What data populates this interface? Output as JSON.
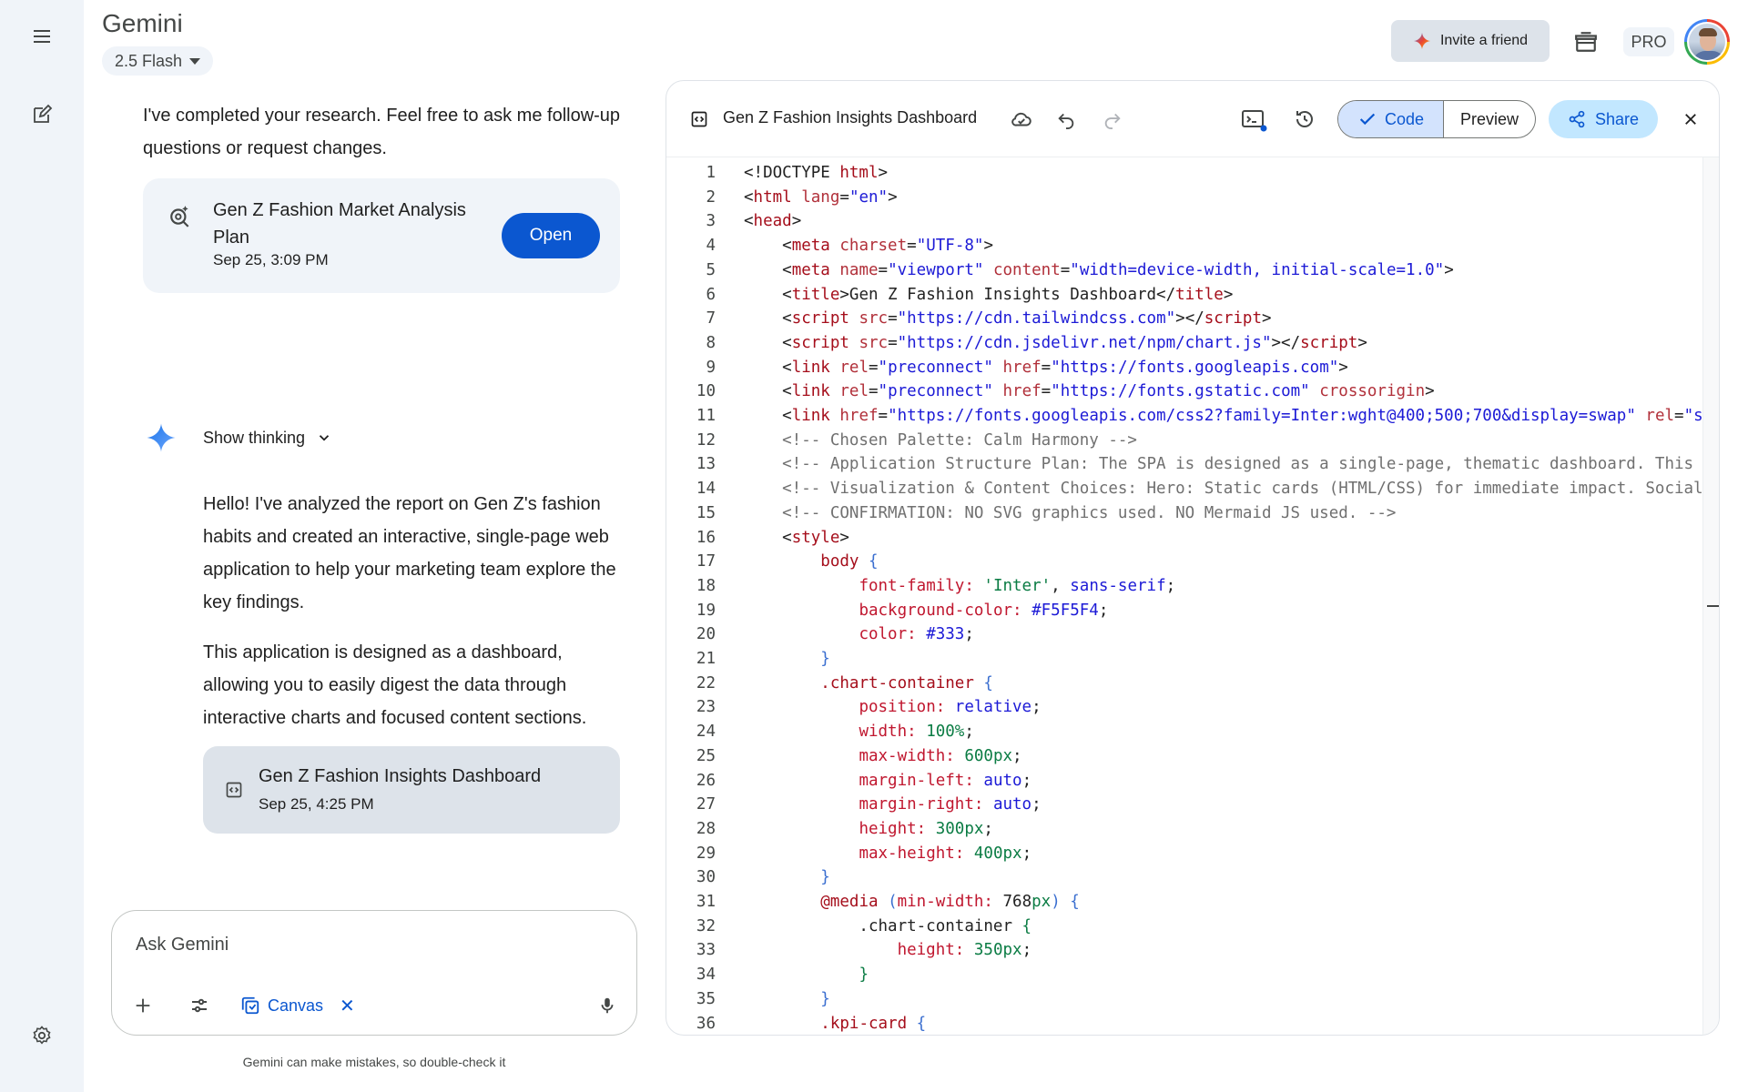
{
  "app": {
    "title": "Gemini",
    "model": "2.5 Flash"
  },
  "header": {
    "invite": "Invite a friend",
    "plan": "PRO"
  },
  "chat": {
    "intro": "I've completed your research. Feel free to ask me follow-up questions or request changes.",
    "research_card": {
      "title": "Gen Z Fashion Market Analysis Plan",
      "date": "Sep 25, 3:09 PM",
      "open": "Open"
    },
    "show_thinking": "Show thinking",
    "para1": "Hello! I've analyzed the report on Gen Z's fashion habits and created an interactive, single-page web application to help your marketing team explore the key findings.",
    "para2": "This application is designed as a dashboard, allowing you to easily digest the data through interactive charts and focused content sections.",
    "doc_card": {
      "title": "Gen Z Fashion Insights Dashboard",
      "date": "Sep 25, 4:25 PM"
    }
  },
  "input": {
    "placeholder": "Ask Gemini",
    "tool_chip": "Canvas"
  },
  "disclaimer": "Gemini can make mistakes, so double-check it",
  "canvas": {
    "title": "Gen Z Fashion Insights Dashboard",
    "tabs": {
      "code": "Code",
      "preview": "Preview"
    },
    "share": "Share",
    "colors": {
      "accent": "#0b57d0",
      "code_tab_bg": "#d3e3fd",
      "share_bg": "#c2e7ff"
    },
    "code_lines": [
      [
        [
          "c-p",
          "<!DOCTYPE "
        ],
        [
          "c-t",
          "html"
        ],
        [
          "c-p",
          ">"
        ]
      ],
      [
        [
          "c-p",
          "<"
        ],
        [
          "c-t",
          "html "
        ],
        [
          "c-a",
          "lang"
        ],
        [
          "c-p",
          "="
        ],
        [
          "c-s",
          "\"en\""
        ],
        [
          "c-p",
          ">"
        ]
      ],
      [
        [
          "c-p",
          "<"
        ],
        [
          "c-t",
          "head"
        ],
        [
          "c-p",
          ">"
        ]
      ],
      [
        [
          "c-p",
          "    <"
        ],
        [
          "c-t",
          "meta "
        ],
        [
          "c-a",
          "charset"
        ],
        [
          "c-p",
          "="
        ],
        [
          "c-s",
          "\"UTF-8\""
        ],
        [
          "c-p",
          ">"
        ]
      ],
      [
        [
          "c-p",
          "    <"
        ],
        [
          "c-t",
          "meta "
        ],
        [
          "c-a",
          "name"
        ],
        [
          "c-p",
          "="
        ],
        [
          "c-s",
          "\"viewport\" "
        ],
        [
          "c-a",
          "content"
        ],
        [
          "c-p",
          "="
        ],
        [
          "c-s",
          "\"width=device-width, initial-scale=1.0\""
        ],
        [
          "c-p",
          ">"
        ]
      ],
      [
        [
          "c-p",
          "    <"
        ],
        [
          "c-t",
          "title"
        ],
        [
          "c-p",
          ">Gen Z Fashion Insights Dashboard</"
        ],
        [
          "c-t",
          "title"
        ],
        [
          "c-p",
          ">"
        ]
      ],
      [
        [
          "c-p",
          "    <"
        ],
        [
          "c-t",
          "script "
        ],
        [
          "c-a",
          "src"
        ],
        [
          "c-p",
          "="
        ],
        [
          "c-s",
          "\"https://cdn.tailwindcss.com\""
        ],
        [
          "c-p",
          "></"
        ],
        [
          "c-t",
          "script"
        ],
        [
          "c-p",
          ">"
        ]
      ],
      [
        [
          "c-p",
          "    <"
        ],
        [
          "c-t",
          "script "
        ],
        [
          "c-a",
          "src"
        ],
        [
          "c-p",
          "="
        ],
        [
          "c-s",
          "\"https://cdn.jsdelivr.net/npm/chart.js\""
        ],
        [
          "c-p",
          "></"
        ],
        [
          "c-t",
          "script"
        ],
        [
          "c-p",
          ">"
        ]
      ],
      [
        [
          "c-p",
          "    <"
        ],
        [
          "c-t",
          "link "
        ],
        [
          "c-a",
          "rel"
        ],
        [
          "c-p",
          "="
        ],
        [
          "c-s",
          "\"preconnect\" "
        ],
        [
          "c-a",
          "href"
        ],
        [
          "c-p",
          "="
        ],
        [
          "c-s",
          "\"https://fonts.googleapis.com\""
        ],
        [
          "c-p",
          ">"
        ]
      ],
      [
        [
          "c-p",
          "    <"
        ],
        [
          "c-t",
          "link "
        ],
        [
          "c-a",
          "rel"
        ],
        [
          "c-p",
          "="
        ],
        [
          "c-s",
          "\"preconnect\" "
        ],
        [
          "c-a",
          "href"
        ],
        [
          "c-p",
          "="
        ],
        [
          "c-s",
          "\"https://fonts.gstatic.com\" "
        ],
        [
          "c-a",
          "crossorigin"
        ],
        [
          "c-p",
          ">"
        ]
      ],
      [
        [
          "c-p",
          "    <"
        ],
        [
          "c-t",
          "link "
        ],
        [
          "c-a",
          "href"
        ],
        [
          "c-p",
          "="
        ],
        [
          "c-s",
          "\"https://fonts.googleapis.com/css2?family=Inter:wght@400;500;700&display=swap\" "
        ],
        [
          "c-a",
          "rel"
        ],
        [
          "c-p",
          "="
        ],
        [
          "c-s",
          "\"st"
        ]
      ],
      [
        [
          "c-c",
          "    <!-- Chosen Palette: Calm Harmony -->"
        ]
      ],
      [
        [
          "c-c",
          "    <!-- Application Structure Plan: The SPA is designed as a single-page, thematic dashboard. This s"
        ]
      ],
      [
        [
          "c-c",
          "    <!-- Visualization & Content Choices: Hero: Static cards (HTML/CSS) for immediate impact. Social"
        ]
      ],
      [
        [
          "c-c",
          "    <!-- CONFIRMATION: NO SVG graphics used. NO Mermaid JS used. -->"
        ]
      ],
      [
        [
          "c-p",
          "    <"
        ],
        [
          "c-t",
          "style"
        ],
        [
          "c-p",
          ">"
        ]
      ],
      [
        [
          "c-p",
          "        "
        ],
        [
          "c-t",
          "body "
        ],
        [
          "c-b",
          "{"
        ]
      ],
      [
        [
          "c-p",
          "            "
        ],
        [
          "c-pr",
          "font-family: "
        ],
        [
          "c-n",
          "'Inter'"
        ],
        [
          "c-p",
          ", "
        ],
        [
          "c-s",
          "sans-serif"
        ],
        [
          "c-p",
          ";"
        ]
      ],
      [
        [
          "c-p",
          "            "
        ],
        [
          "c-pr",
          "background-color: "
        ],
        [
          "c-s",
          "#F5F5F4"
        ],
        [
          "c-p",
          ";"
        ]
      ],
      [
        [
          "c-p",
          "            "
        ],
        [
          "c-pr",
          "color: "
        ],
        [
          "c-s",
          "#333"
        ],
        [
          "c-p",
          ";"
        ]
      ],
      [
        [
          "c-p",
          "        "
        ],
        [
          "c-b",
          "}"
        ]
      ],
      [
        [
          "c-p",
          "        "
        ],
        [
          "c-t",
          ".chart-container "
        ],
        [
          "c-b",
          "{"
        ]
      ],
      [
        [
          "c-p",
          "            "
        ],
        [
          "c-pr",
          "position: "
        ],
        [
          "c-s",
          "relative"
        ],
        [
          "c-p",
          ";"
        ]
      ],
      [
        [
          "c-p",
          "            "
        ],
        [
          "c-pr",
          "width: "
        ],
        [
          "c-n",
          "100%"
        ],
        [
          "c-p",
          ";"
        ]
      ],
      [
        [
          "c-p",
          "            "
        ],
        [
          "c-pr",
          "max-width: "
        ],
        [
          "c-n",
          "600px"
        ],
        [
          "c-p",
          ";"
        ]
      ],
      [
        [
          "c-p",
          "            "
        ],
        [
          "c-pr",
          "margin-left: "
        ],
        [
          "c-s",
          "auto"
        ],
        [
          "c-p",
          ";"
        ]
      ],
      [
        [
          "c-p",
          "            "
        ],
        [
          "c-pr",
          "margin-right: "
        ],
        [
          "c-s",
          "auto"
        ],
        [
          "c-p",
          ";"
        ]
      ],
      [
        [
          "c-p",
          "            "
        ],
        [
          "c-pr",
          "height: "
        ],
        [
          "c-n",
          "300px"
        ],
        [
          "c-p",
          ";"
        ]
      ],
      [
        [
          "c-p",
          "            "
        ],
        [
          "c-pr",
          "max-height: "
        ],
        [
          "c-n",
          "400px"
        ],
        [
          "c-p",
          ";"
        ]
      ],
      [
        [
          "c-p",
          "        "
        ],
        [
          "c-b",
          "}"
        ]
      ],
      [
        [
          "c-p",
          "        "
        ],
        [
          "c-t",
          "@media "
        ],
        [
          "c-b",
          "("
        ],
        [
          "c-pr",
          "min-width: "
        ],
        [
          "c-p",
          "768"
        ],
        [
          "c-n",
          "px"
        ],
        [
          "c-b",
          ") {"
        ]
      ],
      [
        [
          "c-p",
          "            .chart-container "
        ],
        [
          "c-n",
          "{"
        ]
      ],
      [
        [
          "c-p",
          "                "
        ],
        [
          "c-pr",
          "height: "
        ],
        [
          "c-n",
          "350px"
        ],
        [
          "c-p",
          ";"
        ]
      ],
      [
        [
          "c-p",
          "            "
        ],
        [
          "c-n",
          "}"
        ]
      ],
      [
        [
          "c-p",
          "        "
        ],
        [
          "c-b",
          "}"
        ]
      ],
      [
        [
          "c-p",
          "        "
        ],
        [
          "c-t",
          ".kpi-card "
        ],
        [
          "c-b",
          "{"
        ]
      ]
    ]
  }
}
